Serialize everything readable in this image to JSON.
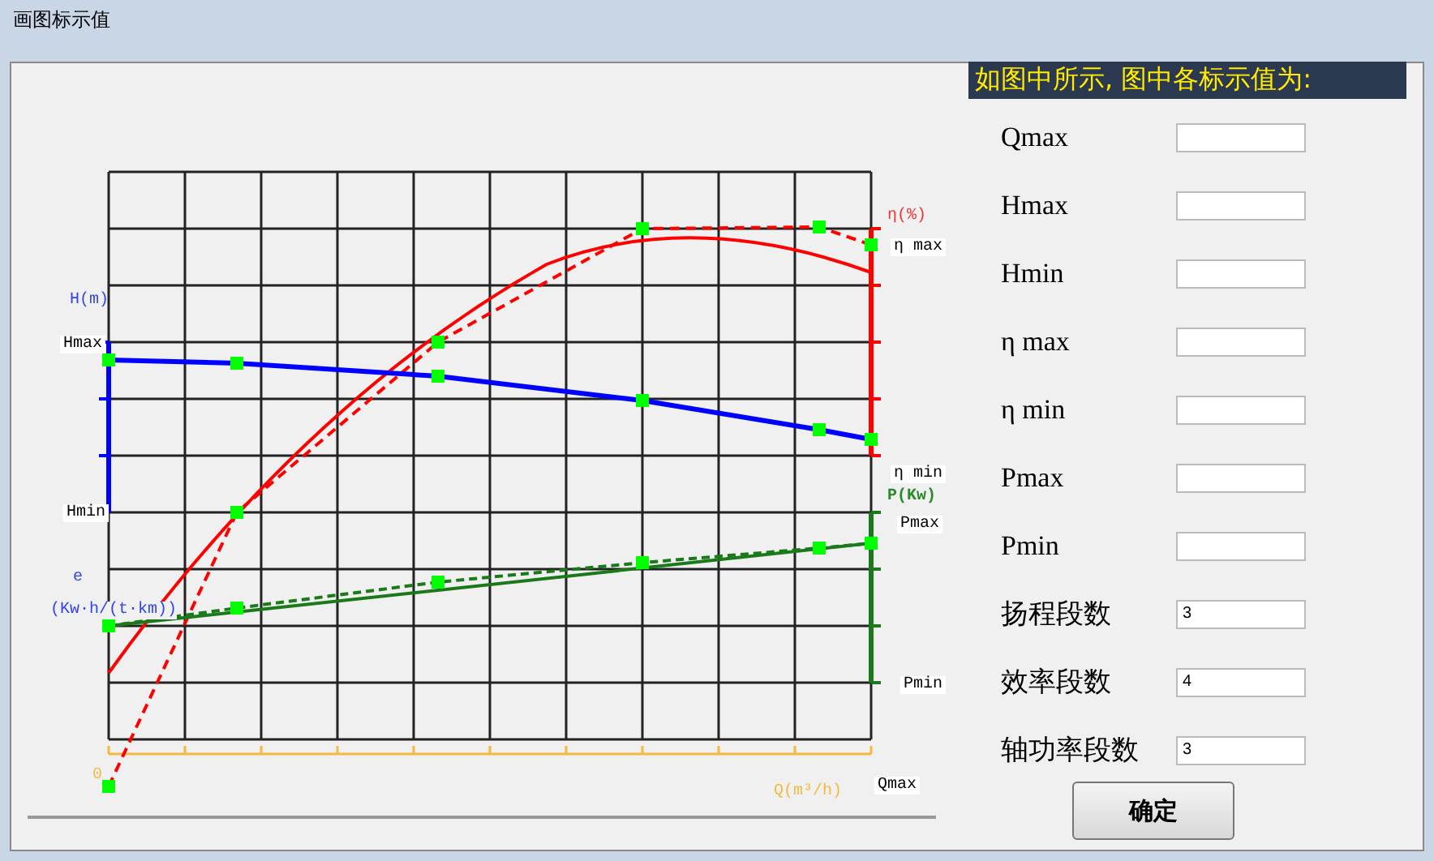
{
  "window": {
    "title": "画图标示值"
  },
  "chart": {
    "h_axis": "H(m)",
    "h_max": "Hmax",
    "h_min": "Hmin",
    "e_axis": "e",
    "e_unit": "(Kw·h/(t·km))",
    "eta_axis": "η(%)",
    "eta_max": "η max",
    "eta_min": "η min",
    "p_axis": "P(Kw)",
    "p_max": "Pmax",
    "p_min": "Pmin",
    "origin": "0",
    "q_axis": "Q(m³/h)",
    "q_max": "Qmax"
  },
  "panel": {
    "heading": "如图中所示, 图中各标示值为:",
    "fields": [
      {
        "label": "Qmax"
      },
      {
        "label": "Hmax"
      },
      {
        "label": "Hmin"
      },
      {
        "label": "η max"
      },
      {
        "label": "η min"
      },
      {
        "label": "Pmax"
      },
      {
        "label": "Pmin"
      },
      {
        "label": "扬程段数",
        "value": "3"
      },
      {
        "label": "效率段数",
        "value": "4"
      },
      {
        "label": "轴功率段数",
        "value": "3"
      }
    ],
    "button": "确定"
  }
}
